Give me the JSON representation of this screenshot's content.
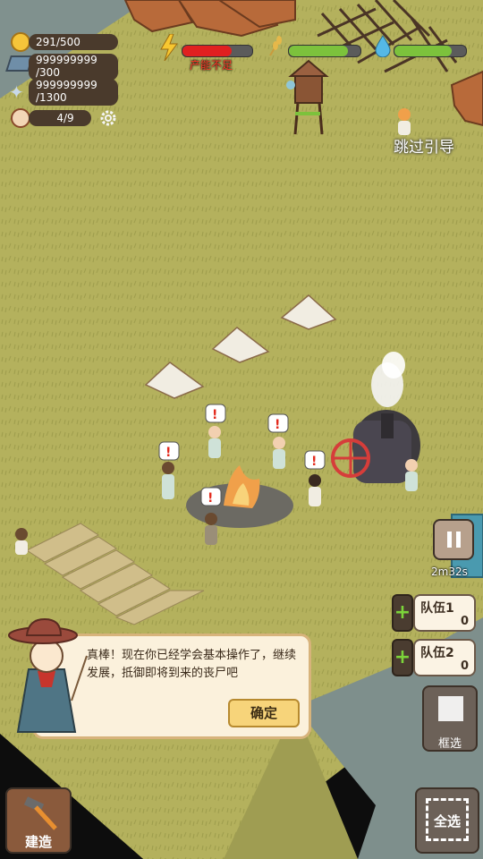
{
  "hud": {
    "gold": {
      "text": "291/500",
      "icon": "gold-coin-icon"
    },
    "steel": {
      "amount": "999999999",
      "capacity": "/300",
      "icon": "steel-ingot-icon"
    },
    "wings": {
      "amount": "999999999",
      "capacity": "/1300",
      "icon": "wing-icon"
    },
    "population": {
      "text": "4/9",
      "icon": "survivor-portrait-icon"
    },
    "settings_icon": "gear-icon"
  },
  "stats": {
    "power": {
      "icon": "lightning-icon",
      "level": 0.7,
      "color": "#e02020",
      "warning": "产能不足",
      "warning_color": "#ff3b2a"
    },
    "food": {
      "icon": "wheat-icon",
      "level": 0.82,
      "color": "#7cc23c"
    },
    "water": {
      "icon": "water-drop-icon",
      "level": 0.8,
      "color": "#7cc23c"
    }
  },
  "skip_tutorial": "跳过引导",
  "dialog": {
    "text": "真棒！现在你已经学会基本操作了，继续发展，抵御即将到来的丧尸吧",
    "confirm_label": "确定"
  },
  "controls": {
    "pause_icon": "pause-icon",
    "timer": "2m32s",
    "team1": {
      "label": "队伍1",
      "count": "0"
    },
    "team2": {
      "label": "队伍2",
      "count": "0"
    },
    "add_icon": "plus-icon",
    "box_select": {
      "label": "框选",
      "icon": "grid-icon"
    },
    "select_all": {
      "label": "全选",
      "icon": "corner-brackets-icon"
    },
    "build": {
      "label": "建造",
      "icon": "hammer-icon"
    }
  },
  "colors": {
    "grass": "#b4b15d",
    "grass_dark": "#9fa04f",
    "river": "#7b8e8d",
    "dialog_bg": "#fbf1dc",
    "confirm_bg": "#f7d47a"
  }
}
